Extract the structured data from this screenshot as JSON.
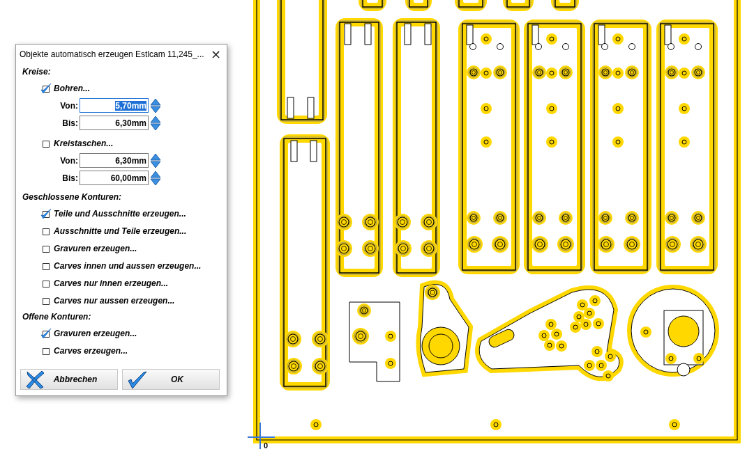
{
  "dialog": {
    "title": "Objekte automatisch erzeugen Estlcam 11,245_...",
    "close": "×",
    "sections": [
      {
        "heading": "Kreise:",
        "items": [
          {
            "kind": "range",
            "label": "Bohren...",
            "checked": true,
            "fields": [
              {
                "label": "Von:",
                "value": "5,70mm",
                "focused": true
              },
              {
                "label": "Bis:",
                "value": "6,30mm",
                "focused": false
              }
            ]
          },
          {
            "kind": "range",
            "label": "Kreistaschen...",
            "checked": false,
            "fields": [
              {
                "label": "Von:",
                "value": "6,30mm",
                "focused": false
              },
              {
                "label": "Bis:",
                "value": "60,00mm",
                "focused": false
              }
            ]
          }
        ]
      },
      {
        "heading": "Geschlossene Konturen:",
        "items": [
          {
            "kind": "check",
            "label": "Teile und Ausschnitte erzeugen...",
            "checked": true
          },
          {
            "kind": "check",
            "label": "Ausschnitte und Teile erzeugen...",
            "checked": false
          },
          {
            "kind": "check",
            "label": "Gravuren erzeugen...",
            "checked": false
          },
          {
            "kind": "check",
            "label": "Carves innen und aussen erzeugen...",
            "checked": false
          },
          {
            "kind": "check",
            "label": "Carves nur innen erzeugen...",
            "checked": false
          },
          {
            "kind": "check",
            "label": "Carves nur aussen erzeugen...",
            "checked": false
          }
        ]
      },
      {
        "heading": "Offene Konturen:",
        "items": [
          {
            "kind": "check",
            "label": "Gravuren erzeugen...",
            "checked": true
          },
          {
            "kind": "check",
            "label": "Carves erzeugen...",
            "checked": false
          }
        ]
      }
    ],
    "buttons": [
      {
        "kind": "cancel",
        "label": "Abbrechen"
      },
      {
        "kind": "ok",
        "label": "OK"
      }
    ]
  },
  "canvas": {
    "origin_label": "0"
  }
}
